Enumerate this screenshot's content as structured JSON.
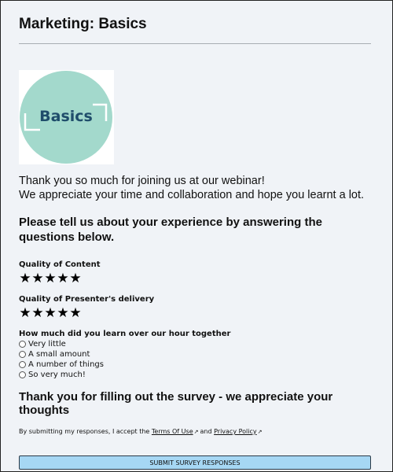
{
  "page": {
    "title": "Marketing: Basics"
  },
  "logo": {
    "text": "Basics",
    "circle_color": "#a3d9cc",
    "text_color": "#1f4d6b",
    "icon": "basics-logo-icon"
  },
  "intro": {
    "line1": "Thank you so much for joining us at our webinar!",
    "line2": "We appreciate your time and collaboration and hope you learnt a lot."
  },
  "prompt": "Please tell us about your experience by answering the questions below.",
  "questions": {
    "content_quality": {
      "label": "Quality of Content",
      "rating": 5,
      "max": 5,
      "star_glyph": "★"
    },
    "presenter_delivery": {
      "label": "Quality of Presenter's delivery",
      "rating": 5,
      "max": 5,
      "star_glyph": "★"
    },
    "learning": {
      "label": "How much did you learn over our hour together",
      "options": [
        "Very little",
        "A small amount",
        "A number of things",
        "So very much!"
      ],
      "selected": null
    }
  },
  "closing": "Thank you for filling out the survey - we appreciate your thoughts",
  "legal": {
    "prefix": "By submitting my responses, I accept the",
    "terms_label": "Terms Of Use",
    "conjunction": "and",
    "privacy_label": "Privacy Policy",
    "external_glyph": "↗"
  },
  "submit": {
    "label": "SUBMIT SURVEY RESPONSES",
    "color": "#a6d7f4"
  }
}
